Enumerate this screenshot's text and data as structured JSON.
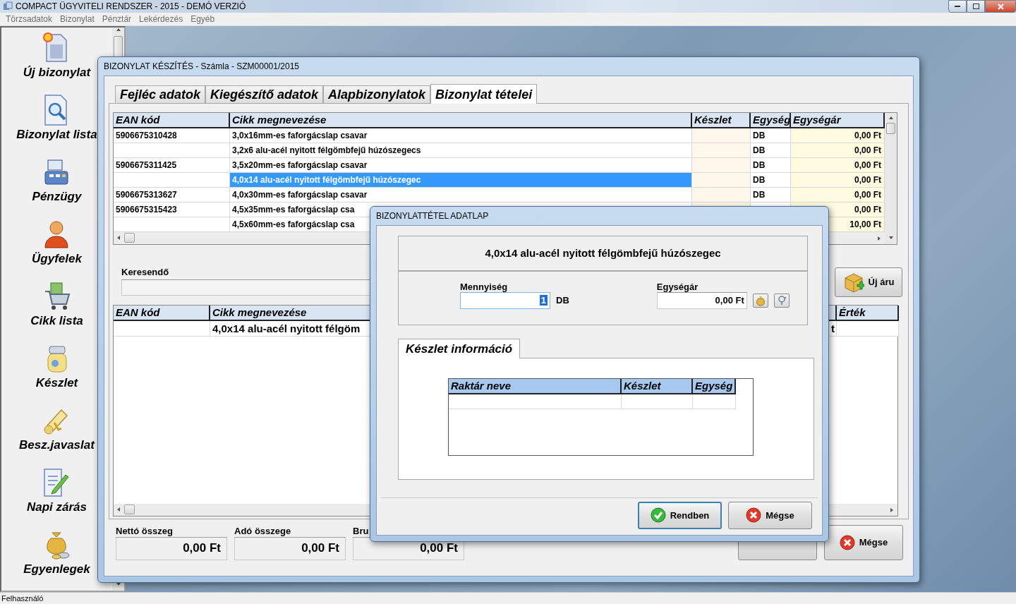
{
  "app": {
    "title": "COMPACT ÜGYVITELI RENDSZER - 2015 - DEMÓ VERZIÓ"
  },
  "menu": [
    "Törzsadatok",
    "Bizonylat",
    "Pénztár",
    "Lekérdezés",
    "Egyéb"
  ],
  "sidebar": {
    "items": [
      {
        "label": "Új bizonylat"
      },
      {
        "label": "Bizonylat lista"
      },
      {
        "label": "Pénzügy"
      },
      {
        "label": "Ügyfelek"
      },
      {
        "label": "Cikk lista"
      },
      {
        "label": "Készlet"
      },
      {
        "label": "Besz.javaslat"
      },
      {
        "label": "Napi zárás"
      },
      {
        "label": "Egyenlegek"
      }
    ]
  },
  "document_window": {
    "title": "BIZONYLAT KÉSZÍTÉS - Számla - SZM00001/2015",
    "tabs": [
      {
        "label": "Fejléc adatok",
        "selected": false
      },
      {
        "label": "Kiegészítő adatok",
        "selected": false
      },
      {
        "label": "Alapbizonylatok",
        "selected": false
      },
      {
        "label": "Bizonylat tételei",
        "selected": true
      }
    ],
    "items_table": {
      "columns": [
        "EAN kód",
        "Cikk megnevezése",
        "Készlet",
        "Egység",
        "Egységár"
      ],
      "rows": [
        {
          "ean": "5906675310428",
          "name": "3,0x16mm-es faforgácslap csavar",
          "unit": "DB",
          "price": "0,00 Ft",
          "selected": false
        },
        {
          "name": "3,2x6 alu-acél nyitott félgömbfejű húzószegecs",
          "unit": "DB",
          "price": "0,00 Ft",
          "selected": false
        },
        {
          "ean": "5906675311425",
          "name": "3,5x20mm-es faforgácslap csavar",
          "unit": "DB",
          "price": "0,00 Ft",
          "selected": false
        },
        {
          "name": "4,0x14 alu-acél nyitott félgömbfejű húzószegec",
          "unit": "DB",
          "price": "0,00 Ft",
          "selected": true
        },
        {
          "ean": "5906675313627",
          "name": "4,0x30mm-es faforgácslap csavar",
          "unit": "DB",
          "price": "0,00 Ft",
          "selected": false
        },
        {
          "ean": "5906675315423",
          "name": "4,5x35mm-es faforgácslap csa",
          "price": "0,00 Ft",
          "selected": false
        },
        {
          "name": "4,5x60mm-es faforgácslap csa",
          "price": "10,00 Ft",
          "selected": false
        }
      ]
    },
    "search": {
      "label": "Keresendő"
    },
    "new_item_button": {
      "label": "Új áru"
    },
    "lines_table": {
      "columns": [
        "EAN kód",
        "Cikk megnevezése",
        "Érték"
      ],
      "rows": [
        {
          "name": "4,0x14 alu-acél nyitott félgöm",
          "column_3": "t"
        }
      ]
    },
    "totals": [
      {
        "label": "Nettó összeg",
        "value": "0,00 Ft"
      },
      {
        "label": "Adó összege",
        "value": "0,00 Ft"
      },
      {
        "label": "Bru",
        "value": "0,00 Ft"
      }
    ],
    "cancel_button": {
      "label": "Mégse"
    }
  },
  "dialog": {
    "title": "BIZONYLATTÉTEL ADATLAP",
    "item_name": "4,0x14 alu-acél nyitott félgömbfejű húzószegec",
    "quantity": {
      "label": "Mennyiség",
      "value": "1",
      "unit": "DB"
    },
    "unit_price": {
      "label": "Egységár",
      "value": "0,00 Ft"
    },
    "tabs": [
      {
        "label": "Készlet információ",
        "selected": true
      }
    ],
    "stock_table": {
      "columns": [
        "Raktár neve",
        "Készlet",
        "Egység"
      ]
    },
    "buttons": [
      {
        "label": "Rendben",
        "kind": "ok",
        "default": true
      },
      {
        "label": "Mégse",
        "kind": "cancel",
        "default": false
      }
    ]
  },
  "status_bar": {
    "text": "Felhasználó"
  }
}
